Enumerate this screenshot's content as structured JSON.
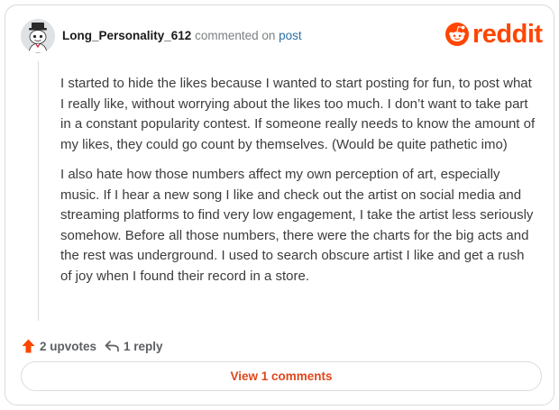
{
  "comment": {
    "username": "Long_Personality_612",
    "action_text": "commented on",
    "link_text": "post",
    "paragraphs": [
      "I started to hide the likes because I wanted to start posting for fun, to post what I really like, without worrying about the likes too much. I don’t want to take part in a constant popularity contest. If someone really needs to know the amount of my likes, they could go count by themselves. (Would be quite pathetic imo)",
      "I also hate how those numbers affect my own perception of art, especially music. If I hear a new song I like and check out the artist on social media and streaming platforms to find very low engagement, I take the artist less seriously somehow. Before all those numbers, there were the charts for the big acts and the rest was underground. I used to search obscure artist I like and get a rush of joy when I found their record in a store."
    ]
  },
  "brand": {
    "name": "reddit",
    "color": "#ff4500",
    "icon": "reddit-alien-icon"
  },
  "footer": {
    "upvotes": "2 upvotes",
    "upvote_icon": "upvote-arrow-icon",
    "replies": "1 reply",
    "reply_icon": "reply-arrow-icon",
    "view_button": "View 1 comments"
  },
  "colors": {
    "accent": "#ff4500",
    "link": "#2a6fa6",
    "text": "#3c3c3c",
    "muted": "#7c7f82"
  }
}
